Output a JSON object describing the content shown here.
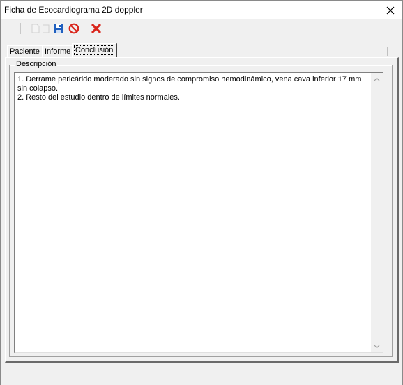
{
  "window": {
    "title": "Ficha de Ecocardiograma 2D doppler"
  },
  "toolbar": {
    "buttons": [
      {
        "icon": "blank-page-icon"
      },
      {
        "icon": "open-folder-icon"
      },
      {
        "icon": "save-icon",
        "color": "#1f5fbf"
      },
      {
        "icon": "cancel-icon",
        "color": "#d9261c"
      },
      {
        "icon": "delete-icon",
        "color": "#d9261c"
      }
    ]
  },
  "tabs": [
    {
      "label": "Paciente",
      "active": false
    },
    {
      "label": "Informe",
      "active": false
    },
    {
      "label": "Conclusión",
      "active": true
    }
  ],
  "conclusion": {
    "group_label": "Descripción",
    "text": "1. Derrame pericárido moderado sin signos de compromiso hemodinámico, vena cava inferior 17 mm sin colapso.\n2. Resto del estudio dentro de límites normales."
  }
}
